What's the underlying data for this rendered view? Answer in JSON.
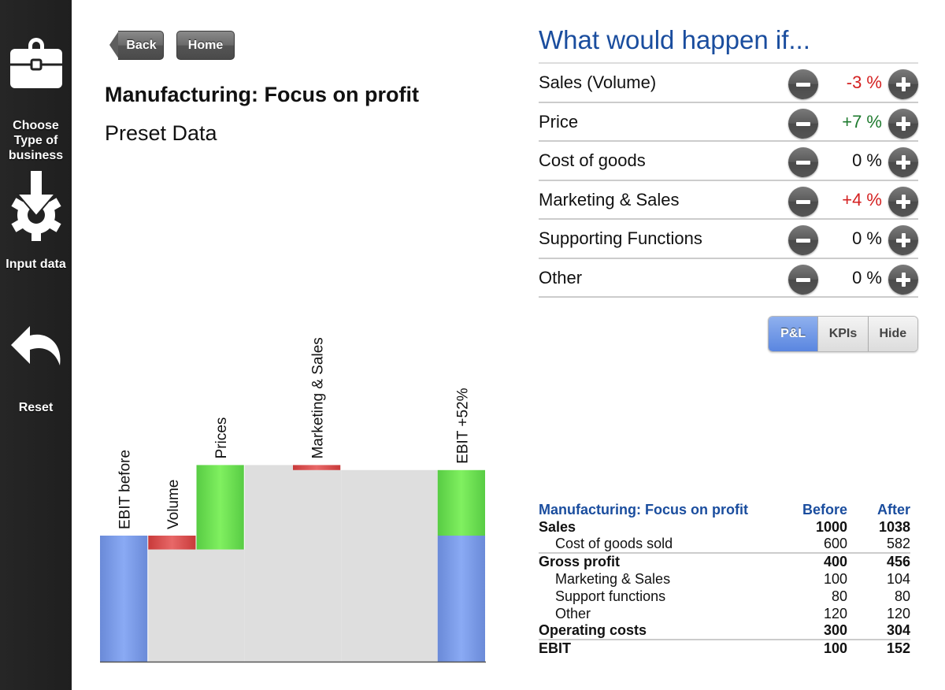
{
  "sidebar": {
    "items": [
      {
        "label": "Choose Type of business",
        "icon": "briefcase-icon"
      },
      {
        "label": "Input data",
        "icon": "download-gear-icon"
      },
      {
        "label": "Reset",
        "icon": "undo-arrow-icon"
      }
    ]
  },
  "nav": {
    "back_label": "Back",
    "home_label": "Home"
  },
  "header": {
    "title": "Manufacturing: Focus on profit",
    "subtitle": "Preset Data"
  },
  "whatif": {
    "title": "What would happen if...",
    "rows": [
      {
        "label": "Sales (Volume)",
        "value": "-3 %",
        "color": "#d42020"
      },
      {
        "label": "Price",
        "value": "+7 %",
        "color": "#1e7a2e"
      },
      {
        "label": "Cost of goods",
        "value": "0 %",
        "color": "#111111"
      },
      {
        "label": "Marketing & Sales",
        "value": "+4 %",
        "color": "#d42020"
      },
      {
        "label": "Supporting Functions",
        "value": "0 %",
        "color": "#111111"
      },
      {
        "label": "Other",
        "value": "0 %",
        "color": "#111111"
      }
    ]
  },
  "view_toggle": {
    "options": [
      "P&L",
      "KPIs",
      "Hide"
    ],
    "selected": "P&L"
  },
  "pl_table": {
    "title": "Manufacturing: Focus on profit",
    "col_before": "Before",
    "col_after": "After",
    "rows": [
      {
        "label": "Sales",
        "before": "1000",
        "after": "1038",
        "style": "bold"
      },
      {
        "label": "Cost of goods sold",
        "before": "600",
        "after": "582",
        "style": "sub"
      },
      {
        "label": "Gross profit",
        "before": "400",
        "after": "456",
        "style": "bold sep"
      },
      {
        "label": "Marketing & Sales",
        "before": "100",
        "after": "104",
        "style": "sub"
      },
      {
        "label": "Support functions",
        "before": "80",
        "after": "80",
        "style": "sub"
      },
      {
        "label": "Other",
        "before": "120",
        "after": "120",
        "style": "sub"
      },
      {
        "label": "Operating costs",
        "before": "300",
        "after": "304",
        "style": "bold"
      },
      {
        "label": "EBIT",
        "before": "100",
        "after": "152",
        "style": "bold sep"
      }
    ]
  },
  "chart_data": {
    "type": "bar",
    "subtype": "waterfall",
    "title": "",
    "xlabel": "",
    "ylabel": "",
    "ylim": [
      0,
      160
    ],
    "grid": false,
    "colors": {
      "start": "#7b9ee8",
      "increase": "#6ae050",
      "decrease": "#d94a4a",
      "background": "#dedede",
      "axis": "#555555"
    },
    "steps": [
      {
        "label": "EBIT before",
        "kind": "total",
        "value": 100
      },
      {
        "label": "Volume",
        "kind": "delta",
        "value": -11
      },
      {
        "label": "Prices",
        "kind": "delta",
        "value": 67
      },
      {
        "label": "",
        "kind": "delta",
        "value": 0
      },
      {
        "label": "Marketing & Sales",
        "kind": "delta",
        "value": -4
      },
      {
        "label": "",
        "kind": "delta",
        "value": 0
      },
      {
        "label": "",
        "kind": "delta",
        "value": 0
      },
      {
        "label": "EBIT +52%",
        "kind": "final",
        "value": 152,
        "base": 100
      }
    ]
  }
}
